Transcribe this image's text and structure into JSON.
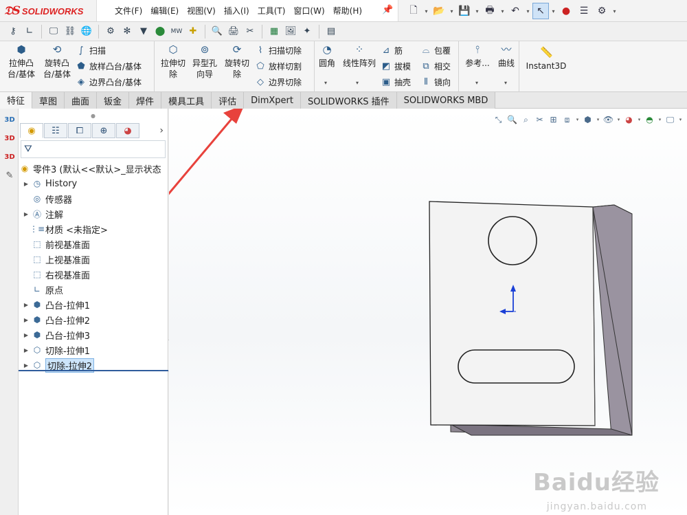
{
  "app": {
    "logo_ds": "ƽ",
    "logo_text": "SOLIDWORKS"
  },
  "menu": [
    "文件(F)",
    "编辑(E)",
    "视图(V)",
    "插入(I)",
    "工具(T)",
    "窗口(W)",
    "帮助(H)"
  ],
  "cmd": {
    "extrude_boss_1": "拉伸凸",
    "extrude_boss_2": "台/基体",
    "revolve_boss_1": "旋转凸",
    "revolve_boss_2": "台/基体",
    "sweep": "扫描",
    "loft": "放样凸台/基体",
    "boundary_boss": "边界凸台/基体",
    "extrude_cut_1": "拉伸切",
    "extrude_cut_2": "除",
    "hole_wizard_1": "异型孔",
    "hole_wizard_2": "向导",
    "revolve_cut_1": "旋转切",
    "revolve_cut_2": "除",
    "swept_cut": "扫描切除",
    "lofted_cut": "放样切割",
    "boundary_cut": "边界切除",
    "fillet": "圆角",
    "linear_pattern": "线性阵列",
    "rib": "筋",
    "draft": "拔模",
    "shell": "抽壳",
    "wrap": "包覆",
    "intersect": "相交",
    "mirror": "镜向",
    "reference": "参考...",
    "curves": "曲线",
    "instant3d": "Instant3D"
  },
  "tabs": [
    "特征",
    "草图",
    "曲面",
    "钣金",
    "焊件",
    "模具工具",
    "评估",
    "DimXpert",
    "SOLIDWORKS 插件",
    "SOLIDWORKS MBD"
  ],
  "tree": {
    "root": "零件3 (默认<<默认>_显示状态",
    "items": [
      {
        "label": "History",
        "expandable": true,
        "icon": "history-icon"
      },
      {
        "label": "传感器",
        "expandable": false,
        "icon": "sensor-icon"
      },
      {
        "label": "注解",
        "expandable": true,
        "icon": "annotation-icon"
      },
      {
        "label": "材质 <未指定>",
        "expandable": false,
        "icon": "material-icon"
      },
      {
        "label": "前视基准面",
        "expandable": false,
        "icon": "plane-icon"
      },
      {
        "label": "上视基准面",
        "expandable": false,
        "icon": "plane-icon"
      },
      {
        "label": "右视基准面",
        "expandable": false,
        "icon": "plane-icon"
      },
      {
        "label": "原点",
        "expandable": false,
        "icon": "origin-icon"
      },
      {
        "label": "凸台-拉伸1",
        "expandable": true,
        "icon": "boss-extrude-icon"
      },
      {
        "label": "凸台-拉伸2",
        "expandable": true,
        "icon": "boss-extrude-icon"
      },
      {
        "label": "凸台-拉伸3",
        "expandable": true,
        "icon": "boss-extrude-icon"
      },
      {
        "label": "切除-拉伸1",
        "expandable": true,
        "icon": "cut-extrude-icon"
      },
      {
        "label": "切除-拉伸2",
        "expandable": true,
        "icon": "cut-extrude-icon",
        "selected": true
      }
    ]
  },
  "watermark": {
    "main": "Baidu经验",
    "sub": "jingyan.baidu.com"
  },
  "colors": {
    "annotation_arrow": "#e8423c",
    "axis_blue": "#1a3fd6",
    "part_face": "#f3f3f3",
    "part_side": "#9a93a0"
  }
}
